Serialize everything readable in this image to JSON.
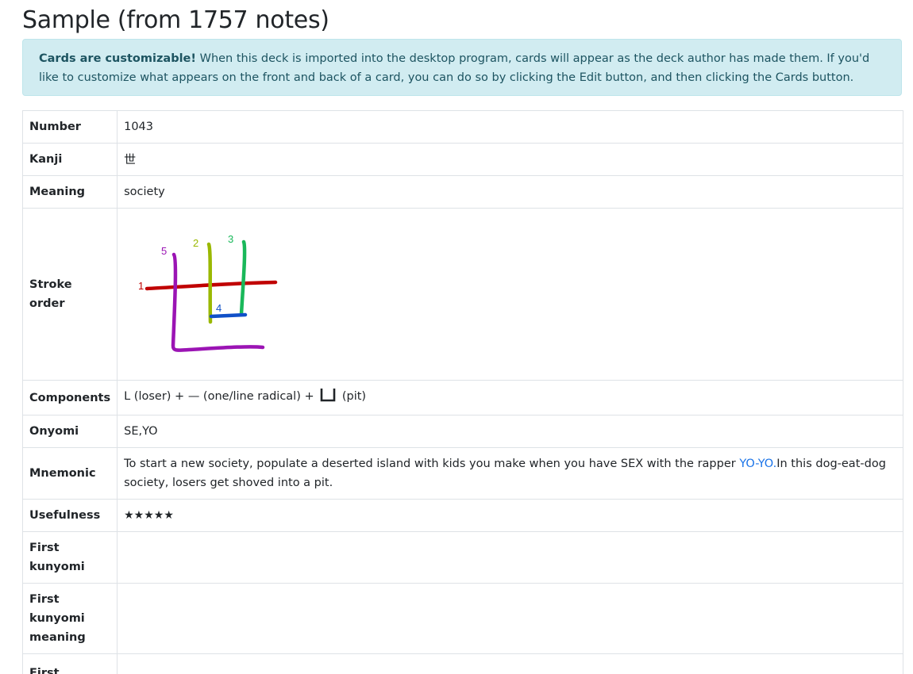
{
  "page_title": "Sample (from 1757 notes)",
  "alert": {
    "strong": "Cards are customizable!",
    "text": " When this deck is imported into the desktop program, cards will appear as the deck author has made them. If you'd like to customize what appears on the front and back of a card, you can do so by clicking the Edit button, and then clicking the Cards button."
  },
  "fields": {
    "number": {
      "label": "Number",
      "value": "1043"
    },
    "kanji": {
      "label": "Kanji",
      "value": "世"
    },
    "meaning": {
      "label": "Meaning",
      "value": "society"
    },
    "stroke_order": {
      "label": "Stroke order",
      "stroke_numbers": [
        "1",
        "2",
        "3",
        "4",
        "5"
      ],
      "stroke_colors": [
        "#c00000",
        "#9ab800",
        "#19b85a",
        "#1050c8",
        "#9b14b4"
      ]
    },
    "components": {
      "label": "Components",
      "part1": "L (loser) + ",
      "part2": "— (one/line radical) + ",
      "part3": " (pit)"
    },
    "onyomi": {
      "label": "Onyomi",
      "value": "SE,YO"
    },
    "mnemonic": {
      "label": "Mnemonic",
      "before": "To start a new society, populate a deserted island with kids you make when you have SEX with the rapper ",
      "link": "YO-YO.",
      "after": "In this dog-eat-dog society, losers get shoved into a pit."
    },
    "usefulness": {
      "label": "Usefulness",
      "value": "★★★★★"
    },
    "first_kunyomi": {
      "label": "First kunyomi",
      "value": ""
    },
    "first_kunyomi_meaning": {
      "label": "First kunyomi meaning",
      "value": ""
    },
    "first_next": {
      "label": "First",
      "value": ""
    }
  }
}
